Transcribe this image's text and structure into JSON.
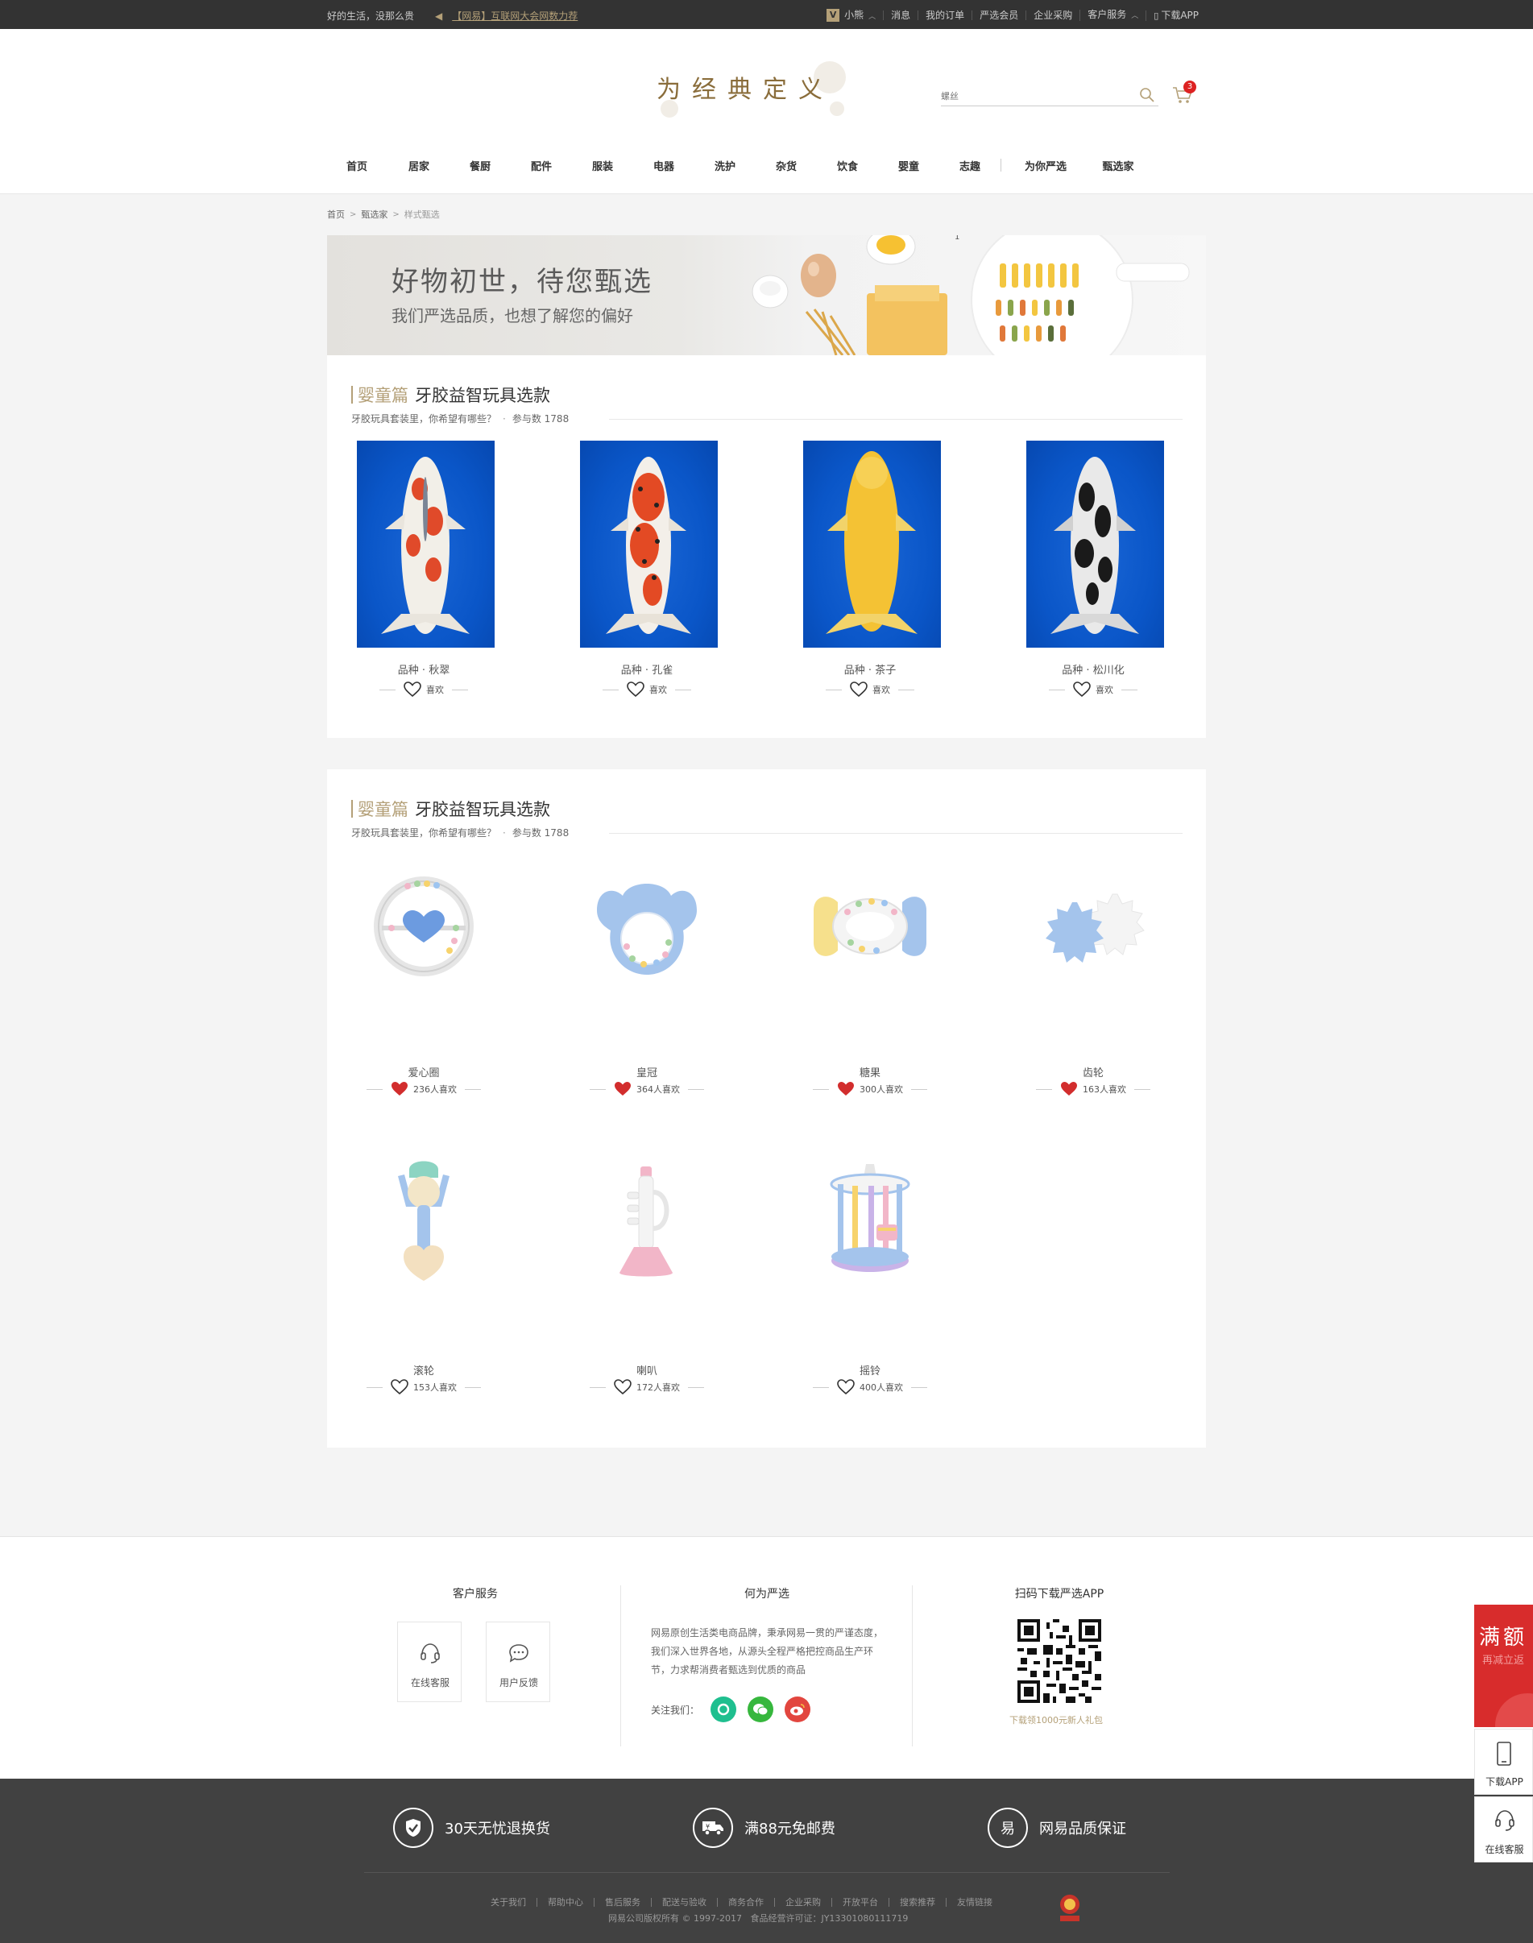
{
  "topbar": {
    "slogan": "好的生活，没那么贵",
    "notice": "【网易】互联网大会网数力荐",
    "items": [
      "小熊",
      "消息",
      "我的订单",
      "严选会员",
      "企业采购",
      "客户服务",
      "下载APP"
    ]
  },
  "header": {
    "logo": "为经典定义",
    "search_placeholder": "螺丝",
    "cart_count": "3"
  },
  "nav": {
    "items": [
      "首页",
      "居家",
      "餐厨",
      "配件",
      "服装",
      "电器",
      "洗护",
      "杂货",
      "饮食",
      "婴童",
      "志趣"
    ],
    "extra": [
      "为你严选",
      "甄选家"
    ]
  },
  "breadcrumb": [
    "首页",
    "甄选家",
    "样式甄选"
  ],
  "banner": {
    "title": "好物初世，待您甄选",
    "subtitle": "我们严选品质，也想了解您的偏好",
    "index": "1"
  },
  "section1": {
    "category": "婴童篇",
    "title": "牙胶益智玩具选款",
    "desc": "牙胶玩具套装里，你希望有哪些？",
    "participants": "参与数 1788",
    "items": [
      {
        "label": "品种",
        "name": "秋翠",
        "like": "喜欢"
      },
      {
        "label": "品种",
        "name": "孔雀",
        "like": "喜欢"
      },
      {
        "label": "品种",
        "name": "茶子",
        "like": "喜欢"
      },
      {
        "label": "品种",
        "name": "松川化",
        "like": "喜欢"
      }
    ]
  },
  "section2": {
    "category": "婴童篇",
    "title": "牙胶益智玩具选款",
    "desc": "牙胶玩具套装里，你希望有哪些？",
    "participants": "参与数 1788",
    "items": [
      {
        "name": "爱心圈",
        "likes": "236人喜欢",
        "liked": true
      },
      {
        "name": "皇冠",
        "likes": "364人喜欢",
        "liked": true
      },
      {
        "name": "糖果",
        "likes": "300人喜欢",
        "liked": true
      },
      {
        "name": "齿轮",
        "likes": "163人喜欢",
        "liked": true
      },
      {
        "name": "滚轮",
        "likes": "153人喜欢",
        "liked": false
      },
      {
        "name": "喇叭",
        "likes": "172人喜欢",
        "liked": false
      },
      {
        "name": "摇铃",
        "likes": "400人喜欢",
        "liked": false
      }
    ]
  },
  "footer": {
    "service_title": "客户服务",
    "online_service": "在线客服",
    "feedback": "用户反馈",
    "about_title": "何为严选",
    "about_text": "网易原创生活类电商品牌，秉承网易一贯的严谨态度，我们深入世界各地，从源头全程严格把控商品生产环节，力求帮消费者甄选到优质的商品",
    "follow": "关注我们：",
    "app_title": "扫码下载严选APP",
    "qr_caption": "下载领1000元新人礼包",
    "promises": [
      "30天无忧退换货",
      "满88元免邮费",
      "网易品质保证"
    ],
    "links": [
      "关于我们",
      "帮助中心",
      "售后服务",
      "配送与验收",
      "商务合作",
      "企业采购",
      "开放平台",
      "搜索推荐",
      "友情链接"
    ],
    "copyright": "网易公司版权所有 © 1997-2017",
    "license": "食品经营许可证：JY13301080111719"
  },
  "side": {
    "promo_big": "满额",
    "promo_small": "再减立返",
    "download": "下载APP",
    "service": "在线客服"
  },
  "colors": {
    "accent": "#b4a078",
    "like_red": "#d22d2d",
    "topbar": "#333333",
    "footer_dark": "#414141"
  }
}
